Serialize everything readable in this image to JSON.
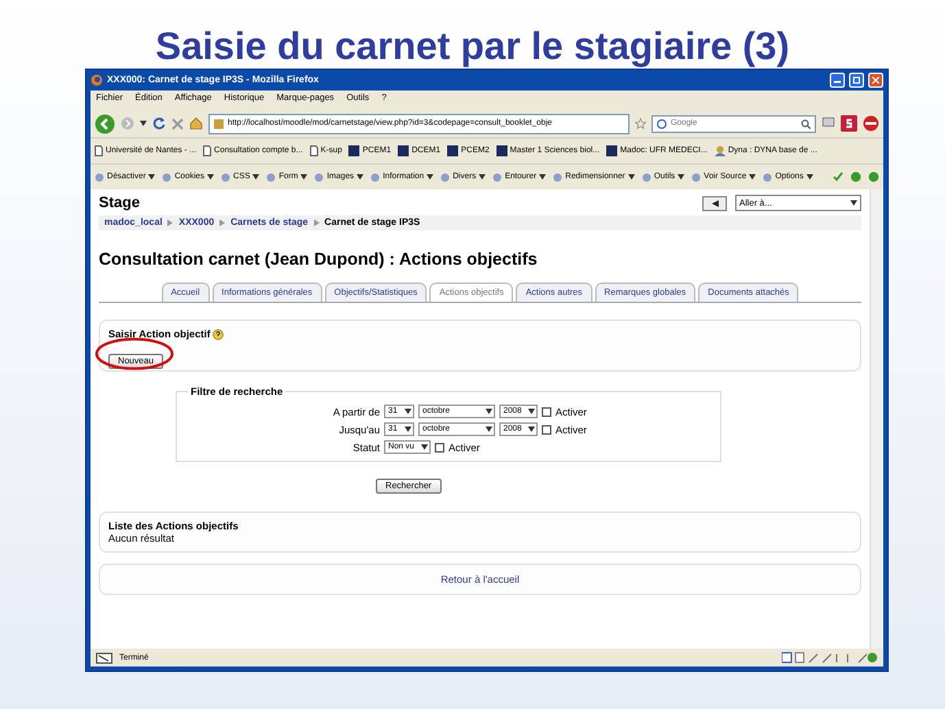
{
  "slide_title": "Saisie du carnet par le stagiaire (3)",
  "browser": {
    "title": "XXX000: Carnet de stage IP3S - Mozilla Firefox",
    "menu": [
      "Fichier",
      "Édition",
      "Affichage",
      "Historique",
      "Marque-pages",
      "Outils",
      "?"
    ],
    "url": "http://localhost/moodle/mod/carnetstage/view.php?id=3&codepage=consult_booklet_obje",
    "search_placeholder": "Google",
    "bookmarks": [
      {
        "label": "Université de Nantes - ...",
        "kind": "page"
      },
      {
        "label": "Consultation compte b...",
        "kind": "page"
      },
      {
        "label": "K-sup",
        "kind": "page"
      },
      {
        "label": "PCEM1",
        "kind": "site"
      },
      {
        "label": "DCEM1",
        "kind": "site"
      },
      {
        "label": "PCEM2",
        "kind": "site"
      },
      {
        "label": "Master 1 Sciences biol...",
        "kind": "site"
      },
      {
        "label": "Madoc: UFR MEDECI...",
        "kind": "site"
      },
      {
        "label": "Dyna : DYNA base de ...",
        "kind": "people"
      }
    ],
    "dev_toolbar": [
      "Désactiver",
      "Cookies",
      "CSS",
      "Form",
      "Images",
      "Information",
      "Divers",
      "Entourer",
      "Redimensionner",
      "Outils",
      "Voir Source",
      "Options"
    ],
    "status": "Terminé"
  },
  "page": {
    "site_title": "Stage",
    "jump_select": "Aller à...",
    "breadcrumb": [
      "madoc_local",
      "XXX000",
      "Carnets de stage",
      "Carnet de stage IP3S"
    ],
    "heading": "Consultation carnet (Jean Dupond) : Actions objectifs",
    "tabs": [
      {
        "label": "Accueil",
        "selected": false
      },
      {
        "label": "Informations générales",
        "selected": false
      },
      {
        "label": "Objectifs/Statistiques",
        "selected": false
      },
      {
        "label": "Actions objectifs",
        "selected": true
      },
      {
        "label": "Actions autres",
        "selected": false
      },
      {
        "label": "Remarques globales",
        "selected": false
      },
      {
        "label": "Documents attachés",
        "selected": false
      }
    ],
    "add_section": {
      "label": "Saisir Action objectif",
      "button": "Nouveau",
      "highlighted": true
    },
    "filter": {
      "legend": "Filtre de recherche",
      "rows": [
        {
          "label": "A partir de",
          "kind": "date",
          "day": "31",
          "month": "octobre",
          "year": "2008",
          "check_label": "Activer",
          "checked": false
        },
        {
          "label": "Jusqu'au",
          "kind": "date",
          "day": "31",
          "month": "octobre",
          "year": "2008",
          "check_label": "Activer",
          "checked": false
        },
        {
          "label": "Statut",
          "kind": "status",
          "value": "Non vu",
          "check_label": "Activer",
          "checked": false
        }
      ],
      "button": "Rechercher"
    },
    "results": {
      "title": "Liste des Actions objectifs",
      "empty": "Aucun résultat"
    },
    "back_link": "Retour à l'accueil"
  }
}
